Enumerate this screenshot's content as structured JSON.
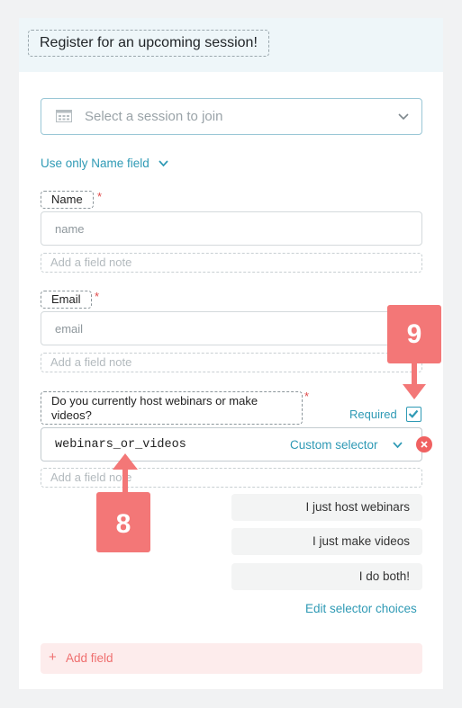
{
  "form": {
    "title": "Register for an upcoming session!",
    "session_select_placeholder": "Select a session to join",
    "name_mode_link": "Use only Name field",
    "required_marker": "*",
    "name_field": {
      "label": "Name",
      "placeholder": "name",
      "note_placeholder": "Add a field note"
    },
    "email_field": {
      "label": "Email",
      "placeholder": "email",
      "note_placeholder": "Add a field note"
    },
    "custom_field": {
      "label": "Do you currently host webinars or make videos?",
      "required_label": "Required",
      "required_checked": true,
      "selector_value": "webinars_or_videos",
      "selector_type": "Custom selector",
      "note_placeholder": "Add a field note",
      "choices": [
        "I just host webinars",
        "I just make videos",
        "I do both!"
      ],
      "edit_choices_link": "Edit selector choices"
    },
    "add_field_label": "Add field"
  },
  "annotations": {
    "badge_8": "8",
    "badge_9": "9"
  },
  "colors": {
    "accent": "#2f9ab5",
    "danger": "#f06161",
    "badge": "#f37777",
    "add_field_bg": "#fdecec"
  }
}
